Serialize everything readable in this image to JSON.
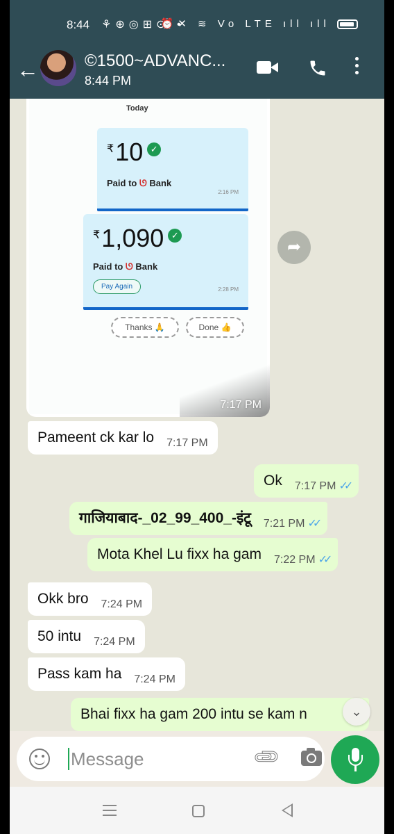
{
  "status_bar": {
    "time": "8:44",
    "left_icons": "⚘⊕◎⊞⊙ •",
    "right_icons": "⏰✕ ≋ Vo LTE ıll ıll"
  },
  "header": {
    "title": "©1500~ADVANC...",
    "subtitle": "8:44 PM"
  },
  "image_message": {
    "day_label": "Today",
    "payments": [
      {
        "amount": "10",
        "currency": "₹",
        "paid_to": "Paid to",
        "bank": "Bank",
        "time": "2:16 PM"
      },
      {
        "amount": "1,090",
        "currency": "₹",
        "paid_to": "Paid to",
        "bank": "Bank",
        "time": "2:28 PM",
        "action": "Pay Again"
      }
    ],
    "chips": [
      "Thanks 🙏",
      "Done 👍"
    ],
    "time": "7:17 PM"
  },
  "messages": [
    {
      "dir": "in",
      "text": "Pameent ck kar lo",
      "time": "7:17 PM"
    },
    {
      "dir": "out",
      "text": "Ok",
      "time": "7:17 PM",
      "ticks": "✓✓"
    },
    {
      "dir": "out",
      "text": "गाजियाबाद-_02_99_400_-इंटू",
      "time": "7:21 PM",
      "ticks": "✓✓"
    },
    {
      "dir": "out",
      "text": "Mota Khel Lu fixx ha gam",
      "time": "7:22 PM",
      "ticks": "✓✓"
    },
    {
      "dir": "in",
      "text": "Okk bro",
      "time": "7:24 PM"
    },
    {
      "dir": "in",
      "text": "50 intu",
      "time": "7:24 PM"
    },
    {
      "dir": "in",
      "text": "Pass kam ha",
      "time": "7:24 PM"
    },
    {
      "dir": "out",
      "text": "Bhai fixx ha gam 200 intu se kam n"
    }
  ],
  "composer": {
    "placeholder": "Message"
  },
  "colors": {
    "header": "#2f4c55",
    "outgoing_bubble": "#e6fdd1",
    "incoming_bubble": "#ffffff",
    "accent_green": "#1fa855",
    "read_ticks": "#4ea6e8"
  },
  "icons": {
    "back": "arrow-left-icon",
    "video": "video-call-icon",
    "call": "phone-icon",
    "menu": "more-vert-icon",
    "forward": "forward-icon",
    "scroll": "chevrons-down-icon",
    "emoji": "emoji-icon",
    "attach": "paperclip-icon",
    "camera": "camera-icon",
    "mic": "mic-icon"
  }
}
